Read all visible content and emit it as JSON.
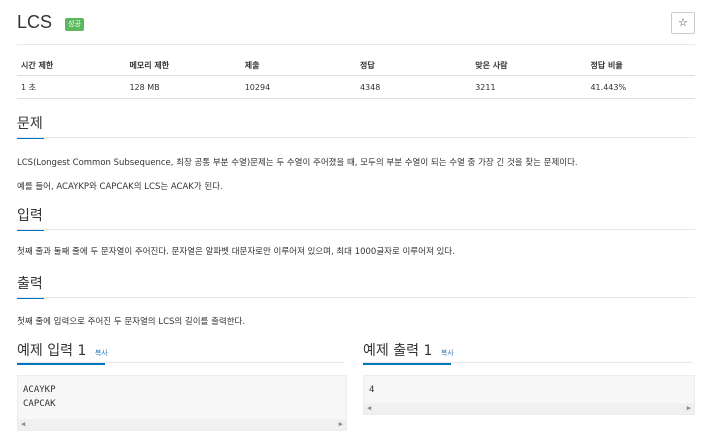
{
  "problem": {
    "title": "LCS",
    "badge": "성공",
    "star_icon": "☆"
  },
  "info_table": {
    "headers": [
      "시간 제한",
      "메모리 제한",
      "제출",
      "정답",
      "맞은 사람",
      "정답 비율"
    ],
    "values": [
      "1 초",
      "128 MB",
      "10294",
      "4348",
      "3211",
      "41.443%"
    ]
  },
  "sections": {
    "problem": {
      "title": "문제",
      "paragraphs": [
        "LCS(Longest Common Subsequence, 최장 공통 부분 수열)문제는 두 수열이 주어졌을 때, 모두의 부분 수열이 되는 수열 중 가장 긴 것을 찾는 문제이다.",
        "예를 들어, ACAYKP와 CAPCAK의 LCS는 ACAK가 된다."
      ]
    },
    "input": {
      "title": "입력",
      "paragraphs": [
        "첫째 줄과 둘째 줄에 두 문자열이 주어진다. 문자열은 알파벳 대문자로만 이루어져 있으며, 최대 1000글자로 이루어져 있다."
      ]
    },
    "output": {
      "title": "출력",
      "paragraphs": [
        "첫째 줄에 입력으로 주어진 두 문자열의 LCS의 길이를 출력한다."
      ]
    }
  },
  "samples": {
    "input": {
      "title": "예제 입력",
      "number": "1",
      "copy": "복사",
      "content": "ACAYKP\nCAPCAK"
    },
    "output": {
      "title": "예제 출력",
      "number": "1",
      "copy": "복사",
      "content": "4"
    }
  },
  "colors": {
    "accent": "#0076c0",
    "badge": "#5cb85c",
    "link": "#337ab7"
  }
}
